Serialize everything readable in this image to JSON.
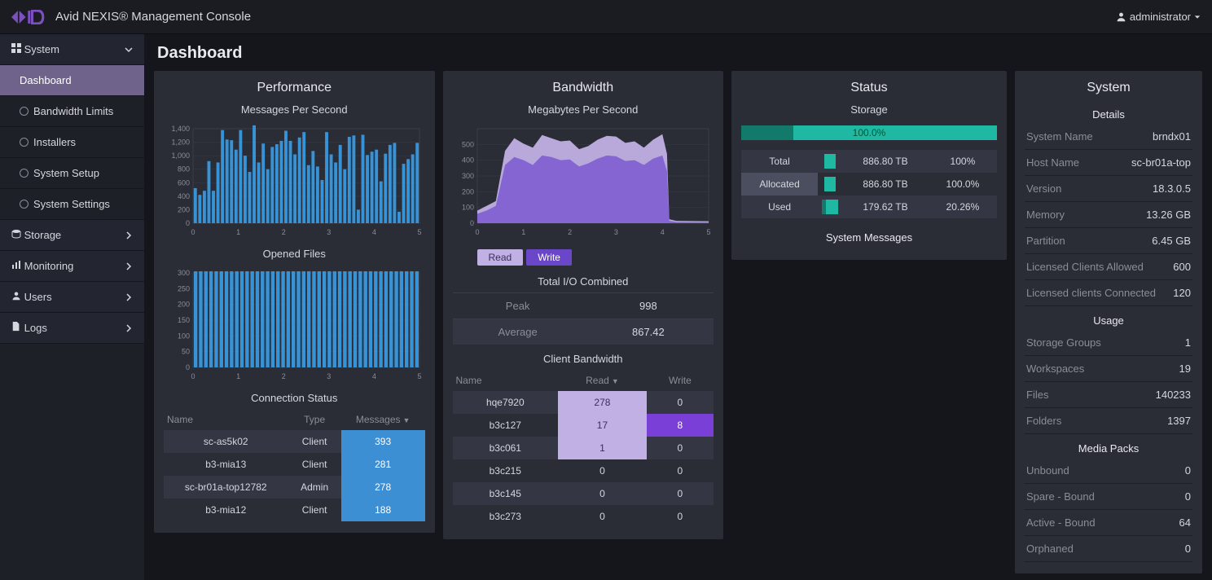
{
  "app_title": "Avid NEXIS® Management Console",
  "user": {
    "label": "administrator"
  },
  "page_title": "Dashboard",
  "sidebar": {
    "groups": [
      {
        "label": "System",
        "icon": "grid-icon",
        "expanded": true,
        "items": [
          {
            "label": "Dashboard",
            "selected": true
          },
          {
            "label": "Bandwidth Limits"
          },
          {
            "label": "Installers"
          },
          {
            "label": "System Setup"
          },
          {
            "label": "System Settings"
          }
        ]
      },
      {
        "label": "Storage",
        "icon": "storage-icon",
        "expanded": false
      },
      {
        "label": "Monitoring",
        "icon": "chart-icon",
        "expanded": false
      },
      {
        "label": "Users",
        "icon": "user-icon",
        "expanded": false
      },
      {
        "label": "Logs",
        "icon": "file-icon",
        "expanded": false
      }
    ]
  },
  "performance": {
    "title": "Performance",
    "chart1": {
      "title": "Messages Per Second"
    },
    "chart2": {
      "title": "Opened Files"
    },
    "conn_title": "Connection Status",
    "conn_headers": {
      "name": "Name",
      "type": "Type",
      "messages": "Messages"
    },
    "conn_rows": [
      {
        "name": "sc-as5k02",
        "type": "Client",
        "messages": 393
      },
      {
        "name": "b3-mia13",
        "type": "Client",
        "messages": 281
      },
      {
        "name": "sc-br01a-top12782",
        "type": "Admin",
        "messages": 278
      },
      {
        "name": "b3-mia12",
        "type": "Client",
        "messages": 188
      }
    ]
  },
  "bandwidth": {
    "title": "Bandwidth",
    "chart": {
      "title": "Megabytes Per Second"
    },
    "tabs": {
      "read": "Read",
      "write": "Write"
    },
    "io_title": "Total I/O Combined",
    "peak": {
      "label": "Peak",
      "value": 998
    },
    "average": {
      "label": "Average",
      "value": 867.42
    },
    "client_title": "Client Bandwidth",
    "client_headers": {
      "name": "Name",
      "read": "Read",
      "write": "Write"
    },
    "client_rows": [
      {
        "name": "hqe7920",
        "read": 278,
        "write": 0,
        "read_hi": true
      },
      {
        "name": "b3c127",
        "read": 17,
        "write": 8,
        "read_hi": true,
        "write_hi": true
      },
      {
        "name": "b3c061",
        "read": 1,
        "write": 0,
        "read_hi": true
      },
      {
        "name": "b3c215",
        "read": 0,
        "write": 0
      },
      {
        "name": "b3c145",
        "read": 0,
        "write": 0
      },
      {
        "name": "b3c273",
        "read": 0,
        "write": 0
      }
    ]
  },
  "status": {
    "title": "Status",
    "storage_label": "Storage",
    "bar_pct": "100.0%",
    "rows": [
      {
        "label": "Total",
        "value": "886.80 TB",
        "pct": "100%",
        "seg": "full"
      },
      {
        "label": "Allocated",
        "value": "886.80 TB",
        "pct": "100.0%",
        "seg": "full"
      },
      {
        "label": "Used",
        "value": "179.62 TB",
        "pct": "20.26%",
        "seg": "used"
      }
    ],
    "sys_msg_title": "System Messages"
  },
  "system": {
    "title": "System",
    "details_title": "Details",
    "details": [
      {
        "k": "System Name",
        "v": "brndx01"
      },
      {
        "k": "Host Name",
        "v": "sc-br01a-top"
      },
      {
        "k": "Version",
        "v": "18.3.0.5"
      },
      {
        "k": "Memory",
        "v": "13.26 GB"
      },
      {
        "k": "Partition",
        "v": "6.45 GB"
      },
      {
        "k": "Licensed Clients Allowed",
        "v": "600"
      },
      {
        "k": "Licensed clients Connected",
        "v": "120"
      }
    ],
    "usage_title": "Usage",
    "usage": [
      {
        "k": "Storage Groups",
        "v": "1"
      },
      {
        "k": "Workspaces",
        "v": "19"
      },
      {
        "k": "Files",
        "v": "140233"
      },
      {
        "k": "Folders",
        "v": "1397"
      }
    ],
    "media_title": "Media Packs",
    "media": [
      {
        "k": "Unbound",
        "v": "0"
      },
      {
        "k": "Spare - Bound",
        "v": "0"
      },
      {
        "k": "Active - Bound",
        "v": "64"
      },
      {
        "k": "Orphaned",
        "v": "0"
      }
    ]
  },
  "chart_data": [
    {
      "type": "bar",
      "title": "Messages Per Second",
      "xlim": [
        0,
        5
      ],
      "ylim": [
        0,
        1400
      ],
      "yticks": [
        0,
        200,
        400,
        600,
        800,
        1000,
        1200,
        1400
      ],
      "xticks": [
        0,
        1,
        2,
        3,
        4,
        5
      ],
      "values": [
        520,
        420,
        480,
        920,
        480,
        900,
        1380,
        1240,
        1230,
        1090,
        1380,
        1000,
        760,
        1450,
        900,
        1180,
        800,
        1130,
        1170,
        1220,
        1370,
        1220,
        1020,
        1270,
        1350,
        860,
        1070,
        840,
        640,
        1350,
        1020,
        900,
        1160,
        800,
        1280,
        1300,
        200,
        1310,
        1010,
        1060,
        1090,
        620,
        1030,
        1160,
        1190,
        170,
        880,
        950,
        1020,
        1190
      ]
    },
    {
      "type": "bar",
      "title": "Opened Files",
      "xlim": [
        0,
        5
      ],
      "ylim": [
        0,
        300
      ],
      "yticks": [
        0,
        50,
        100,
        150,
        200,
        250,
        300
      ],
      "xticks": [
        0,
        1,
        2,
        3,
        4,
        5
      ],
      "values": [
        305,
        305,
        305,
        305,
        305,
        305,
        305,
        305,
        305,
        305,
        305,
        305,
        305,
        305,
        305,
        305,
        305,
        305,
        305,
        305,
        305,
        305,
        305,
        305,
        305,
        305,
        305,
        305,
        305,
        305,
        305,
        305,
        305,
        305,
        305,
        305,
        305,
        305,
        305,
        305,
        305,
        305,
        305,
        305
      ]
    },
    {
      "type": "area",
      "title": "Megabytes Per Second",
      "xlim": [
        0,
        5
      ],
      "ylim": [
        0,
        600
      ],
      "yticks": [
        0,
        100,
        200,
        300,
        400,
        500
      ],
      "xticks": [
        0,
        1,
        2,
        3,
        4,
        5
      ],
      "series": [
        {
          "name": "Read",
          "role": "upper",
          "x": [
            0,
            0.2,
            0.4,
            0.6,
            0.8,
            1.0,
            1.2,
            1.4,
            1.6,
            1.8,
            2.0,
            2.2,
            2.4,
            2.6,
            2.8,
            3.0,
            3.2,
            3.4,
            3.6,
            3.8,
            4.0,
            4.1,
            4.15,
            4.3,
            5.0
          ],
          "y": [
            80,
            110,
            140,
            460,
            540,
            505,
            480,
            560,
            540,
            520,
            525,
            470,
            490,
            530,
            555,
            550,
            510,
            520,
            480,
            530,
            565,
            440,
            25,
            15,
            12
          ]
        },
        {
          "name": "Write",
          "role": "lower",
          "x": [
            0,
            0.2,
            0.4,
            0.6,
            0.8,
            1.0,
            1.2,
            1.4,
            1.6,
            1.8,
            2.0,
            2.2,
            2.4,
            2.6,
            2.8,
            3.0,
            3.2,
            3.4,
            3.6,
            3.8,
            4.0,
            4.1,
            4.15,
            4.3,
            5.0
          ],
          "y": [
            60,
            80,
            110,
            370,
            420,
            400,
            370,
            430,
            420,
            400,
            405,
            360,
            380,
            410,
            430,
            425,
            395,
            400,
            370,
            410,
            430,
            330,
            15,
            8,
            6
          ]
        }
      ]
    }
  ]
}
